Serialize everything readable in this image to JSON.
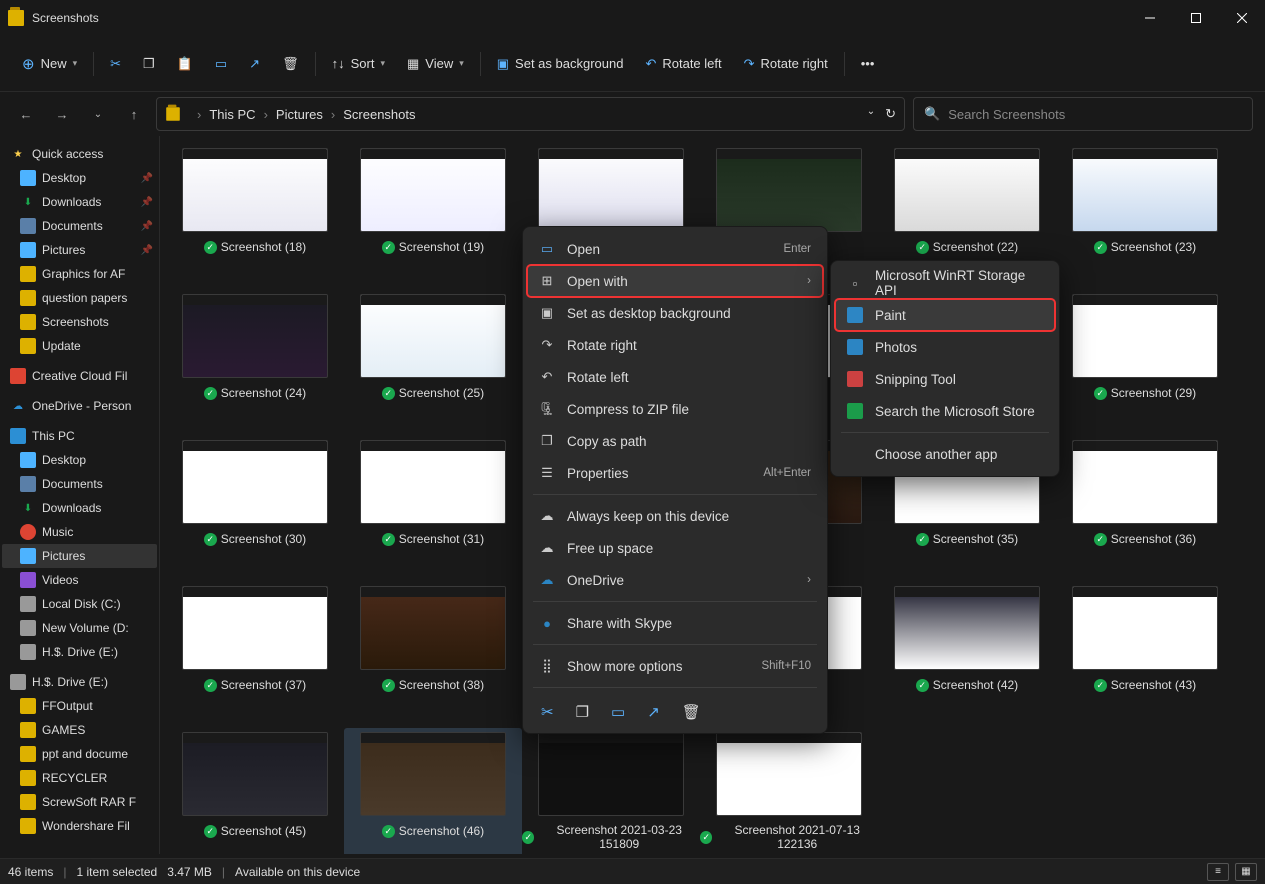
{
  "window": {
    "title": "Screenshots"
  },
  "toolbar": {
    "new_label": "New",
    "sort_label": "Sort",
    "view_label": "View",
    "bg_label": "Set as background",
    "rotate_left_label": "Rotate left",
    "rotate_right_label": "Rotate right"
  },
  "breadcrumb": [
    "This PC",
    "Pictures",
    "Screenshots"
  ],
  "search": {
    "placeholder": "Search Screenshots"
  },
  "sidebar": {
    "quick_access": "Quick access",
    "qa_items": [
      "Desktop",
      "Downloads",
      "Documents",
      "Pictures",
      "Graphics for AF",
      "question papers",
      "Screenshots",
      "Update"
    ],
    "creative": "Creative Cloud Fil",
    "onedrive": "OneDrive - Person",
    "this_pc": "This PC",
    "pc_items": [
      "Desktop",
      "Documents",
      "Downloads",
      "Music",
      "Pictures",
      "Videos",
      "Local Disk (C:)",
      "New Volume (D:",
      "H.$. Drive (E:)"
    ],
    "drive_e": "H.$. Drive (E:)",
    "e_items": [
      "FFOutput",
      "GAMES",
      "ppt and docume",
      "RECYCLER",
      "ScrewSoft RAR F",
      "Wondershare Fil"
    ]
  },
  "files": [
    {
      "label": "Screenshot (18)"
    },
    {
      "label": "Screenshot (19)"
    },
    {
      "label": ""
    },
    {
      "label": ""
    },
    {
      "label": "Screenshot (22)"
    },
    {
      "label": "Screenshot (23)"
    },
    {
      "label": "Screenshot (24)"
    },
    {
      "label": "Screenshot (25)"
    },
    {
      "label": ""
    },
    {
      "label": ""
    },
    {
      "label": ""
    },
    {
      "label": "Screenshot (29)"
    },
    {
      "label": "Screenshot (30)"
    },
    {
      "label": "Screenshot (31)"
    },
    {
      "label": ""
    },
    {
      "label": "3)"
    },
    {
      "label": "Screenshot (35)"
    },
    {
      "label": "Screenshot (36)"
    },
    {
      "label": "Screenshot (37)"
    },
    {
      "label": "Screenshot (38)"
    },
    {
      "label": ""
    },
    {
      "label": ""
    },
    {
      "label": "Screenshot (42)"
    },
    {
      "label": "Screenshot (43)"
    },
    {
      "label": "Screenshot (45)"
    },
    {
      "label": "Screenshot (46)"
    },
    {
      "label": "Screenshot 2021-03-23 151809"
    },
    {
      "label": "Screenshot 2021-07-13 122136"
    }
  ],
  "ctx": {
    "open": "Open",
    "open_shortcut": "Enter",
    "open_with": "Open with",
    "set_bg": "Set as desktop background",
    "rotate_right": "Rotate right",
    "rotate_left": "Rotate left",
    "zip": "Compress to ZIP file",
    "copy_path": "Copy as path",
    "props": "Properties",
    "props_shortcut": "Alt+Enter",
    "keep": "Always keep on this device",
    "free": "Free up space",
    "onedrive": "OneDrive",
    "skype": "Share with Skype",
    "more": "Show more options",
    "more_shortcut": "Shift+F10"
  },
  "submenu": {
    "winrt": "Microsoft WinRT Storage API",
    "paint": "Paint",
    "photos": "Photos",
    "snip": "Snipping Tool",
    "store": "Search the Microsoft Store",
    "another": "Choose another app"
  },
  "status": {
    "count": "46 items",
    "selected": "1 item selected",
    "size": "3.47 MB",
    "avail": "Available on this device"
  }
}
